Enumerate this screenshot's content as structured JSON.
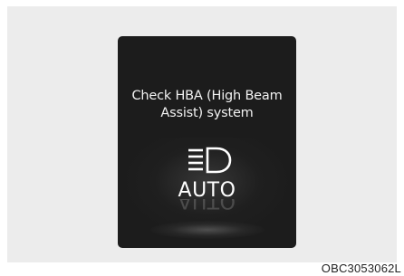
{
  "display": {
    "message_line1": "Check HBA (High Beam",
    "message_line2": "Assist) system",
    "icon": "high-beam-headlamp-icon",
    "mode_label": "AUTO"
  },
  "figure_code": "OBC3053062L",
  "colors": {
    "display_background": "#1c1c1c",
    "panel_background": "#ececec",
    "text": "#f2f2f2"
  }
}
